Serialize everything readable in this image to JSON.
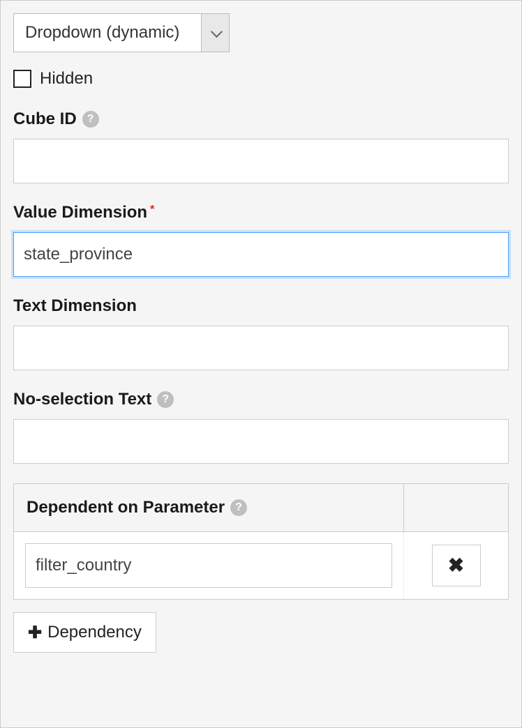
{
  "type_select": {
    "value": "Dropdown (dynamic)"
  },
  "hidden": {
    "label": "Hidden"
  },
  "cube_id": {
    "label": "Cube ID",
    "value": ""
  },
  "value_dimension": {
    "label": "Value Dimension",
    "required": "*",
    "value": "state_province"
  },
  "text_dimension": {
    "label": "Text Dimension",
    "value": ""
  },
  "no_selection": {
    "label": "No-selection Text",
    "value": ""
  },
  "dependencies": {
    "header": "Dependent on Parameter",
    "rows": [
      {
        "value": "filter_country"
      }
    ],
    "add_label": "Dependency"
  }
}
